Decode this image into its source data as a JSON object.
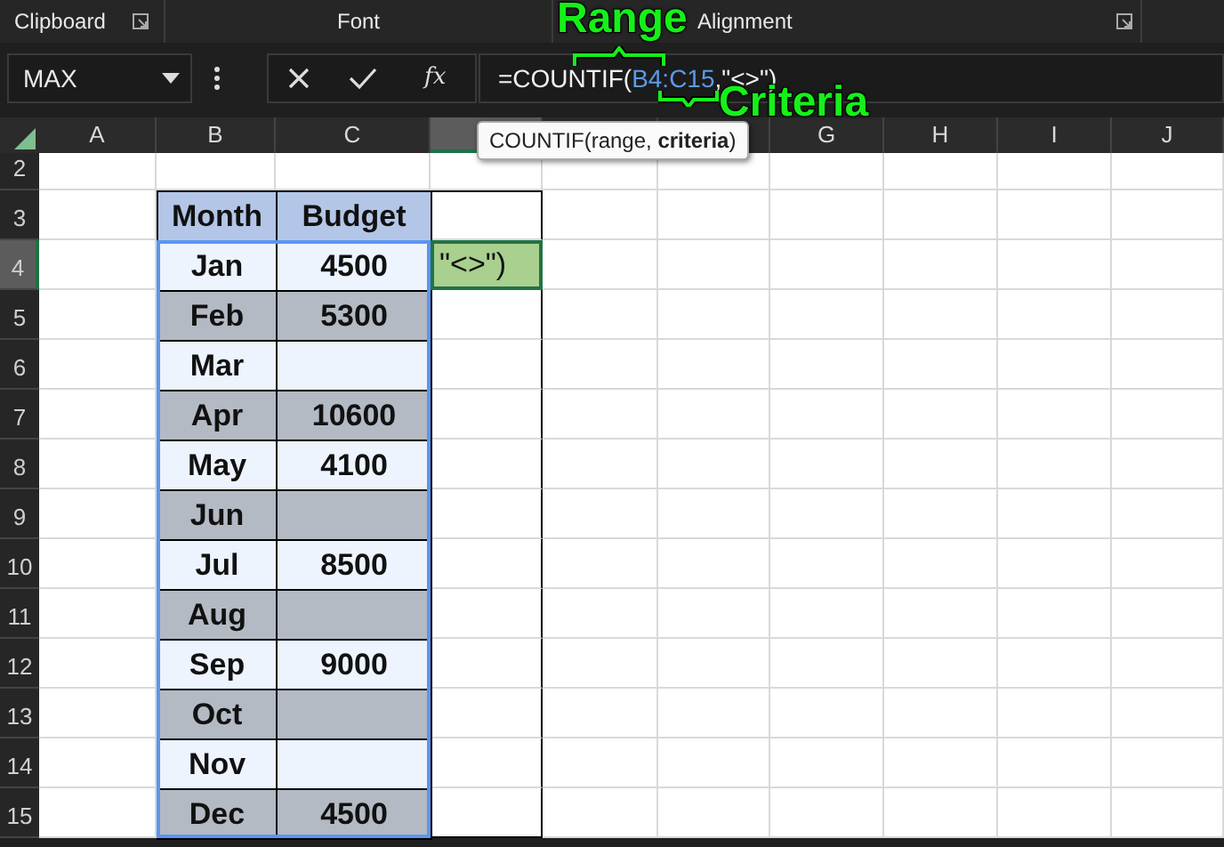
{
  "ribbon_groups": [
    {
      "label": "Clipboard",
      "launcher": true
    },
    {
      "label": "Font",
      "launcher": false
    },
    {
      "label": "Alignment",
      "launcher": true
    }
  ],
  "name_box": "MAX",
  "function_button": "fx",
  "formula": [
    {
      "text": "=COUNTIF(",
      "kind": "plain"
    },
    {
      "text": "B4:C15",
      "kind": "reference"
    },
    {
      "text": ",\"<>\")",
      "kind": "plain"
    }
  ],
  "tooltip": "COUNTIF(range, **criteria**)",
  "columns": [
    {
      "label": "A",
      "selected": false
    },
    {
      "label": "B",
      "selected": false
    },
    {
      "label": "C",
      "selected": false
    },
    {
      "selected": true
    },
    {
      "selected": false
    },
    {
      "selected": false
    },
    {
      "label": "G",
      "selected": false
    },
    {
      "label": "H",
      "selected": false
    },
    {
      "label": "I",
      "selected": false
    },
    {
      "label": "J",
      "selected": false
    }
  ],
  "rows": [
    {
      "label": "2",
      "selected": false
    },
    {
      "label": "3",
      "selected": false
    },
    {
      "label": "4",
      "selected": true
    },
    {
      "label": "5",
      "selected": false
    },
    {
      "label": "6",
      "selected": false
    },
    {
      "label": "7",
      "selected": false
    },
    {
      "label": "8",
      "selected": false
    },
    {
      "label": "9",
      "selected": false
    },
    {
      "label": "10",
      "selected": false
    },
    {
      "label": "11",
      "selected": false
    },
    {
      "label": "12",
      "selected": false
    },
    {
      "label": "13",
      "selected": false
    },
    {
      "label": "14",
      "selected": false
    },
    {
      "label": "15",
      "selected": false
    }
  ],
  "table": {
    "header": [
      "Month",
      "Budget"
    ],
    "range_selected": true,
    "rows": [
      {
        "month": "Jan",
        "budget": "4500",
        "color": "#edf4fd"
      },
      {
        "month": "Feb",
        "budget": "5300",
        "color": "#b4bac3"
      },
      {
        "month": "Mar",
        "budget": "",
        "color": "#edf4fd"
      },
      {
        "month": "Apr",
        "budget": "10600",
        "color": "#b4bac3"
      },
      {
        "month": "May",
        "budget": "4100",
        "color": "#edf4fd"
      },
      {
        "month": "Jun",
        "budget": "",
        "color": "#b4bac3"
      },
      {
        "month": "Jul",
        "budget": "8500",
        "color": "#edf4fd"
      },
      {
        "month": "Aug",
        "budget": "",
        "color": "#b4bac3"
      },
      {
        "month": "Sep",
        "budget": "9000",
        "color": "#edf4fd"
      },
      {
        "month": "Oct",
        "budget": "",
        "color": "#b4bac3"
      },
      {
        "month": "Nov",
        "budget": "",
        "color": "#edf4fd"
      },
      {
        "month": "Dec",
        "budget": "4500",
        "color": "#b4bac3"
      }
    ]
  },
  "active_cell": "\"<>\")",
  "annotations": [
    {
      "label": "Range",
      "kind": "range"
    },
    {
      "label": "Criteria",
      "kind": "criteria"
    }
  ]
}
